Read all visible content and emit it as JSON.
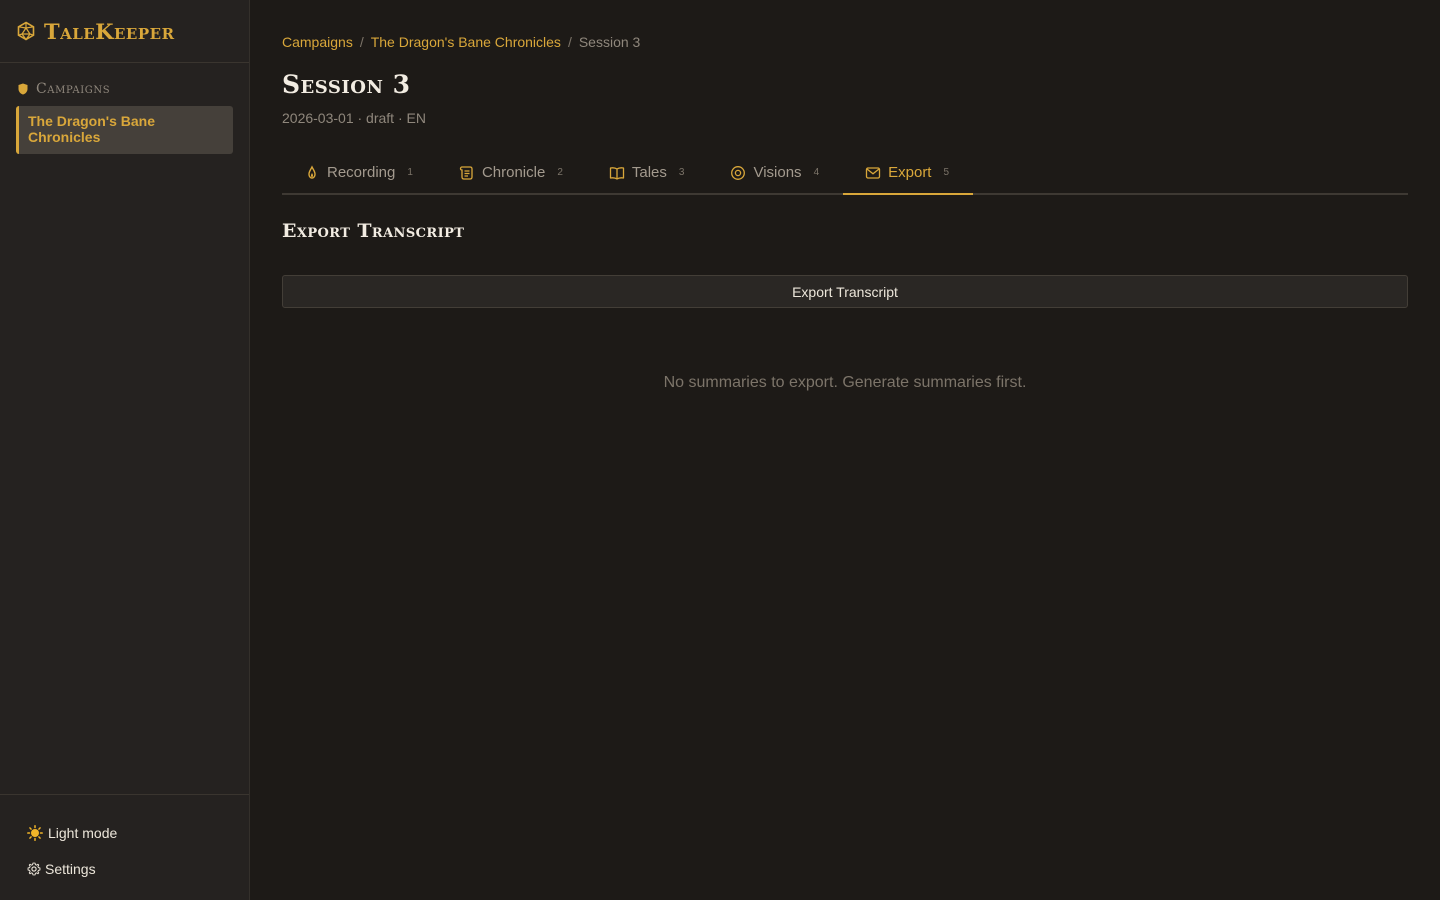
{
  "app": {
    "name": "TaleKeeper",
    "accent": "#d9a73a",
    "background": "#1d1a17",
    "sidebar_background": "#252220"
  },
  "sidebar": {
    "section_label": "Campaigns",
    "campaigns": [
      {
        "label": "The Dragon's Bane Chronicles",
        "active": true
      }
    ],
    "footer": {
      "theme_toggle": "Light mode",
      "settings": "Settings"
    }
  },
  "breadcrumb": {
    "items": [
      "Campaigns",
      "The Dragon's Bane Chronicles"
    ],
    "current": "Session 3",
    "separator": "/"
  },
  "session": {
    "title": "Session 3",
    "meta": "2026-03-01 · draft · EN"
  },
  "tabs": [
    {
      "label": "Recording",
      "number": "1",
      "icon": "flame-icon"
    },
    {
      "label": "Chronicle",
      "number": "2",
      "icon": "scroll-icon"
    },
    {
      "label": "Tales",
      "number": "3",
      "icon": "book-icon"
    },
    {
      "label": "Visions",
      "number": "4",
      "icon": "eye-icon"
    },
    {
      "label": "Export",
      "number": "5",
      "icon": "mail-icon",
      "active": true
    }
  ],
  "export": {
    "heading": "Export Transcript",
    "button_label": "Export Transcript",
    "empty_message": "No summaries to export. Generate summaries first."
  }
}
